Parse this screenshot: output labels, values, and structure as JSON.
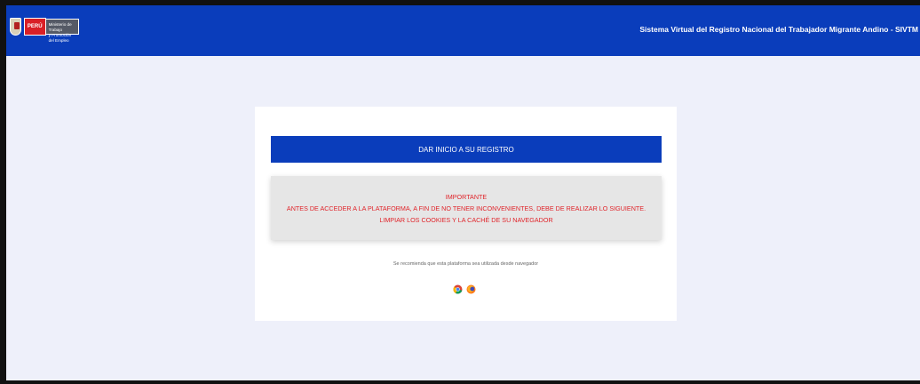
{
  "header": {
    "logo": {
      "country": "PERÚ",
      "ministry_line1": "Ministerio de Trabajo",
      "ministry_line2": "y Promoción del Empleo"
    },
    "title": "Sistema Virtual del Registro Nacional del Trabajador Migrante Andino - SIVTM"
  },
  "card": {
    "start_button": "DAR INICIO A SU REGISTRO",
    "alert": {
      "heading": "IMPORTANTE",
      "line1": "ANTES DE ACCEDER A LA PLATAFORMA, A FIN DE NO TENER INCONVENIENTES, DEBE DE REALIZAR LO SIGUIENTE.",
      "line2": "LIMPIAR LOS COOKIES Y LA CACHÉ DE SU NAVEGADOR"
    },
    "recommendation": "Se recomienda que esta plataforma sea utilizada desde navegador",
    "browsers": [
      "chrome-icon",
      "firefox-icon"
    ]
  },
  "colors": {
    "header_bg": "#0a3dbb",
    "page_bg": "#eef0fa",
    "alert_text": "#e0242a",
    "alert_bg": "#e6e6e6"
  }
}
